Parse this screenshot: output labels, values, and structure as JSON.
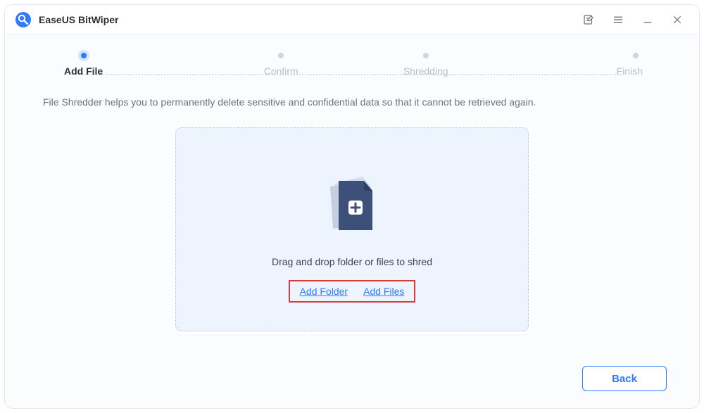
{
  "app": {
    "title": "EaseUS BitWiper"
  },
  "steps": [
    {
      "label": "Add File",
      "active": true
    },
    {
      "label": "Confirm",
      "active": false
    },
    {
      "label": "Shredding",
      "active": false
    },
    {
      "label": "Finish",
      "active": false
    }
  ],
  "description": "File Shredder helps you to permanently delete sensitive and confidential data so that it cannot be retrieved again.",
  "dropzone": {
    "instruction": "Drag and drop folder or files to shred",
    "add_folder_label": "Add Folder",
    "add_files_label": "Add Files"
  },
  "buttons": {
    "back": "Back"
  }
}
